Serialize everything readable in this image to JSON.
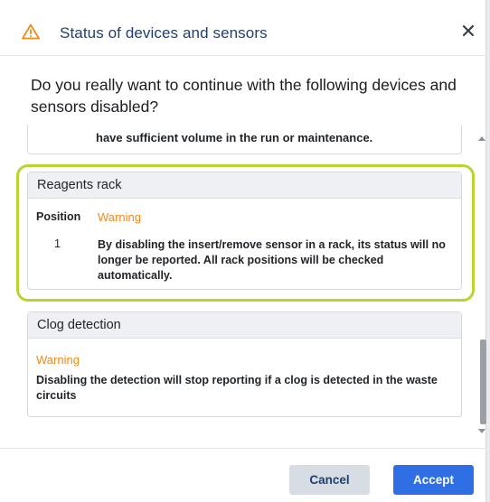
{
  "dialog": {
    "title": "Status of devices and sensors",
    "close_symbol": "✕",
    "question": "Do you really want to continue with the following devices and sensors disabled?"
  },
  "previous_item": {
    "text_tail": "have sufficient volume in the run or maintenance."
  },
  "rack_card": {
    "title": "Reagents rack",
    "position_label": "Position",
    "warning_label": "Warning",
    "position_value": "1",
    "message": "By disabling the insert/remove sensor in a rack, its status will no longer be reported. All rack positions will be checked automatically.",
    "highlighted": true
  },
  "clog_card": {
    "title": "Clog detection",
    "warning_label": "Warning",
    "message": "Disabling the detection will stop reporting if a clog is detected in the waste circuits"
  },
  "footer": {
    "cancel_label": "Cancel",
    "accept_label": "Accept"
  },
  "icons": {
    "header": "warning-triangle-icon",
    "close": "close-icon"
  },
  "colors": {
    "title": "#1f3f73",
    "warning": "#f08a1c",
    "highlight": "#b6d531",
    "accept": "#2f6fe3",
    "cancel": "#d7dde3"
  }
}
